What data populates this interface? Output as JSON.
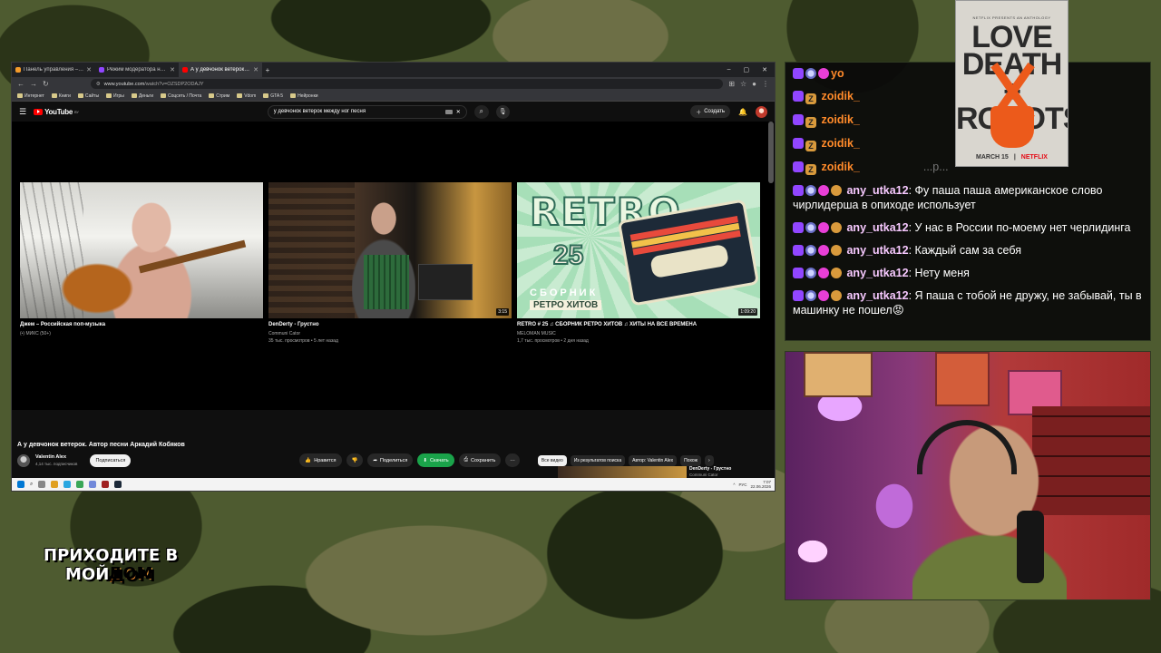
{
  "browser": {
    "tabs": [
      {
        "label": "Панель управления – Donatio",
        "color": "#f49b2b",
        "active": false
      },
      {
        "label": "Режим модератора на канале",
        "color": "#9146ff",
        "active": false
      },
      {
        "label": "А у девчонок ветерок. Автор п",
        "color": "#ff0000",
        "active": true
      }
    ],
    "url_host": "www.youtube.com",
    "url_path": "/watch?v=OZSDP2ODAJY",
    "bookmarks": [
      "Интернет",
      "Книги",
      "Сайты",
      "Игры",
      "Деньги",
      "Соцсеть / Почта",
      "Стрим",
      "Vdom",
      "GTA 5",
      "Нейронки"
    ]
  },
  "youtube": {
    "logo_text": "YouTube",
    "logo_region": "BY",
    "search_query": "у девчонок ветерок между ног песня",
    "create_label": "Создать",
    "endcards": [
      {
        "title": "Джем – Российская поп-музыка",
        "channel": "(•) МИКС (50+)",
        "meta": "",
        "duration": ""
      },
      {
        "title": "DenDerty - Грустно",
        "channel": "Communi Cator",
        "meta": "35 тыс. просмотров • 5 лет назад",
        "duration": "3:15"
      },
      {
        "title": "RETRO # 25 ♫ СБОРНИК РЕТРО ХИТОВ ♫ ХИТЫ НА ВСЕ ВРЕМЕНА",
        "channel": "MELOMAN MUSIC",
        "meta": "1,7 тыс. просмотров • 2 дня назад",
        "duration": "1:09:20"
      }
    ],
    "thumb3": {
      "word": "RETRO",
      "num": "25",
      "sub1": "СБОРНИК",
      "sub2": "РЕТРО ХИТОВ"
    },
    "video_title": "А у девчонок ветерок. Автор песни Аркадий Кобяков",
    "channel_name": "Valentin Alex",
    "channel_subs": "4,14 тыс. подписчиков",
    "subscribe_label": "Подписаться",
    "actions": {
      "like": "Нравится",
      "share": "Поделиться",
      "download": "Скачать",
      "save": "Сохранить"
    },
    "chips": [
      "Все видео",
      "Из результатов поиска",
      "Автор: Valentin Alex",
      "Похож"
    ],
    "rec": {
      "title": "DenDerty - Грустно",
      "channel": "Communi Cator"
    }
  },
  "taskbar": {
    "lang": "РУС",
    "time": "7:07",
    "date": "22.06.2026"
  },
  "poster": {
    "top": "NETFLIX PRESENTS AN ANTHOLOGY",
    "title": "LOVE DEATH + ROBOTS",
    "date": "MARCH 15",
    "brand": "NETFLIX"
  },
  "chat": {
    "partial": [
      {
        "user": "yo",
        "text": ""
      },
      {
        "user": "zoidik_",
        "text": ""
      },
      {
        "user": "zoidik_",
        "text": ""
      },
      {
        "user": "zoidik_",
        "text": ""
      },
      {
        "user": "zoidik_",
        "text": "...р..."
      }
    ],
    "messages": [
      {
        "user": "any_utka12",
        "text": ": Фу паша паша американское слово чирлидерша в опиходе использует"
      },
      {
        "user": "any_utka12",
        "text": ": У нас в России по-моему нет черлидинга"
      },
      {
        "user": "any_utka12",
        "text": ": Каждый сам за себя"
      },
      {
        "user": "any_utka12",
        "text": ": Нету меня"
      },
      {
        "user": "any_utka12",
        "text": ": Я паша с тобой не дружу, не забывай, ты в машинку не пошел😡"
      }
    ]
  },
  "overlay": {
    "line1": "ПРИХОДИТЕ В",
    "line2a": "МОЙ",
    "line2b": "ДОМ"
  }
}
